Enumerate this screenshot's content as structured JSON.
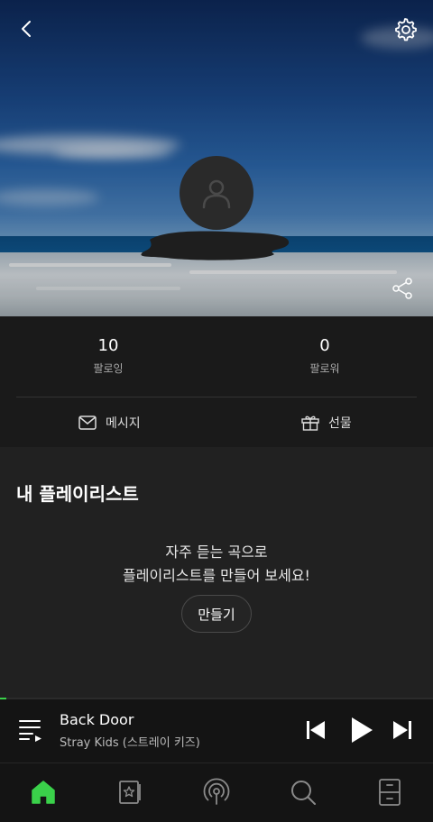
{
  "profile": {
    "following_count": "10",
    "following_label": "팔로잉",
    "followers_count": "0",
    "followers_label": "팔로워"
  },
  "actions": {
    "message_label": "메시지",
    "gift_label": "선물"
  },
  "playlist_section": {
    "title": "내 플레이리스트",
    "empty_line1": "자주 듣는 곡으로",
    "empty_line2": "플레이리스트를 만들어 보세요!",
    "create_button": "만들기"
  },
  "player": {
    "track_title": "Back Door",
    "artist": "Stray Kids (스트레이 키즈)",
    "progress_fraction": 0.015
  },
  "nav": {
    "items": [
      "home-icon",
      "library-icon",
      "podcast-icon",
      "search-icon",
      "storage-icon"
    ],
    "active": "home-icon"
  },
  "colors": {
    "accent": "#3ad14a",
    "background": "#1f1f1f"
  }
}
